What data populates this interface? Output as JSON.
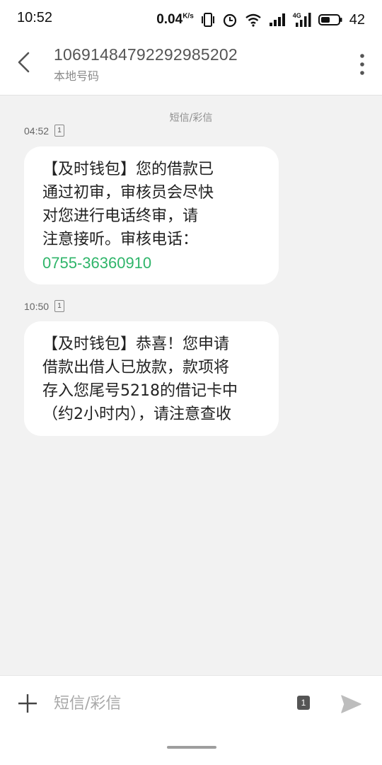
{
  "status_bar": {
    "time": "10:52",
    "net_speed": "0.04",
    "net_speed_unit": "K/s",
    "network_type": "4G",
    "battery": "42"
  },
  "header": {
    "number": "10691484792292985202",
    "subtitle": "本地号码"
  },
  "conversation": {
    "channel_label": "短信/彩信",
    "messages": [
      {
        "time": "04:52",
        "sim": "1",
        "lines": [
          "【及时钱包】您的借款已",
          "通过初审，审核员会尽快",
          "对您进行电话终审，请",
          "注意接听。审核电话："
        ],
        "phone": "0755-36360910"
      },
      {
        "time": "10:50",
        "sim": "1",
        "lines": [
          "【及时钱包】恭喜！您申请",
          "借款出借人已放款，款项将",
          "存入您尾号5218的借记卡中",
          "（约2小时内），请注意查收"
        ]
      }
    ]
  },
  "compose": {
    "placeholder": "短信/彩信",
    "value": "",
    "sim": "1"
  },
  "colors": {
    "link": "#2fb56a",
    "background": "#f2f2f2",
    "bubble": "#ffffff"
  }
}
